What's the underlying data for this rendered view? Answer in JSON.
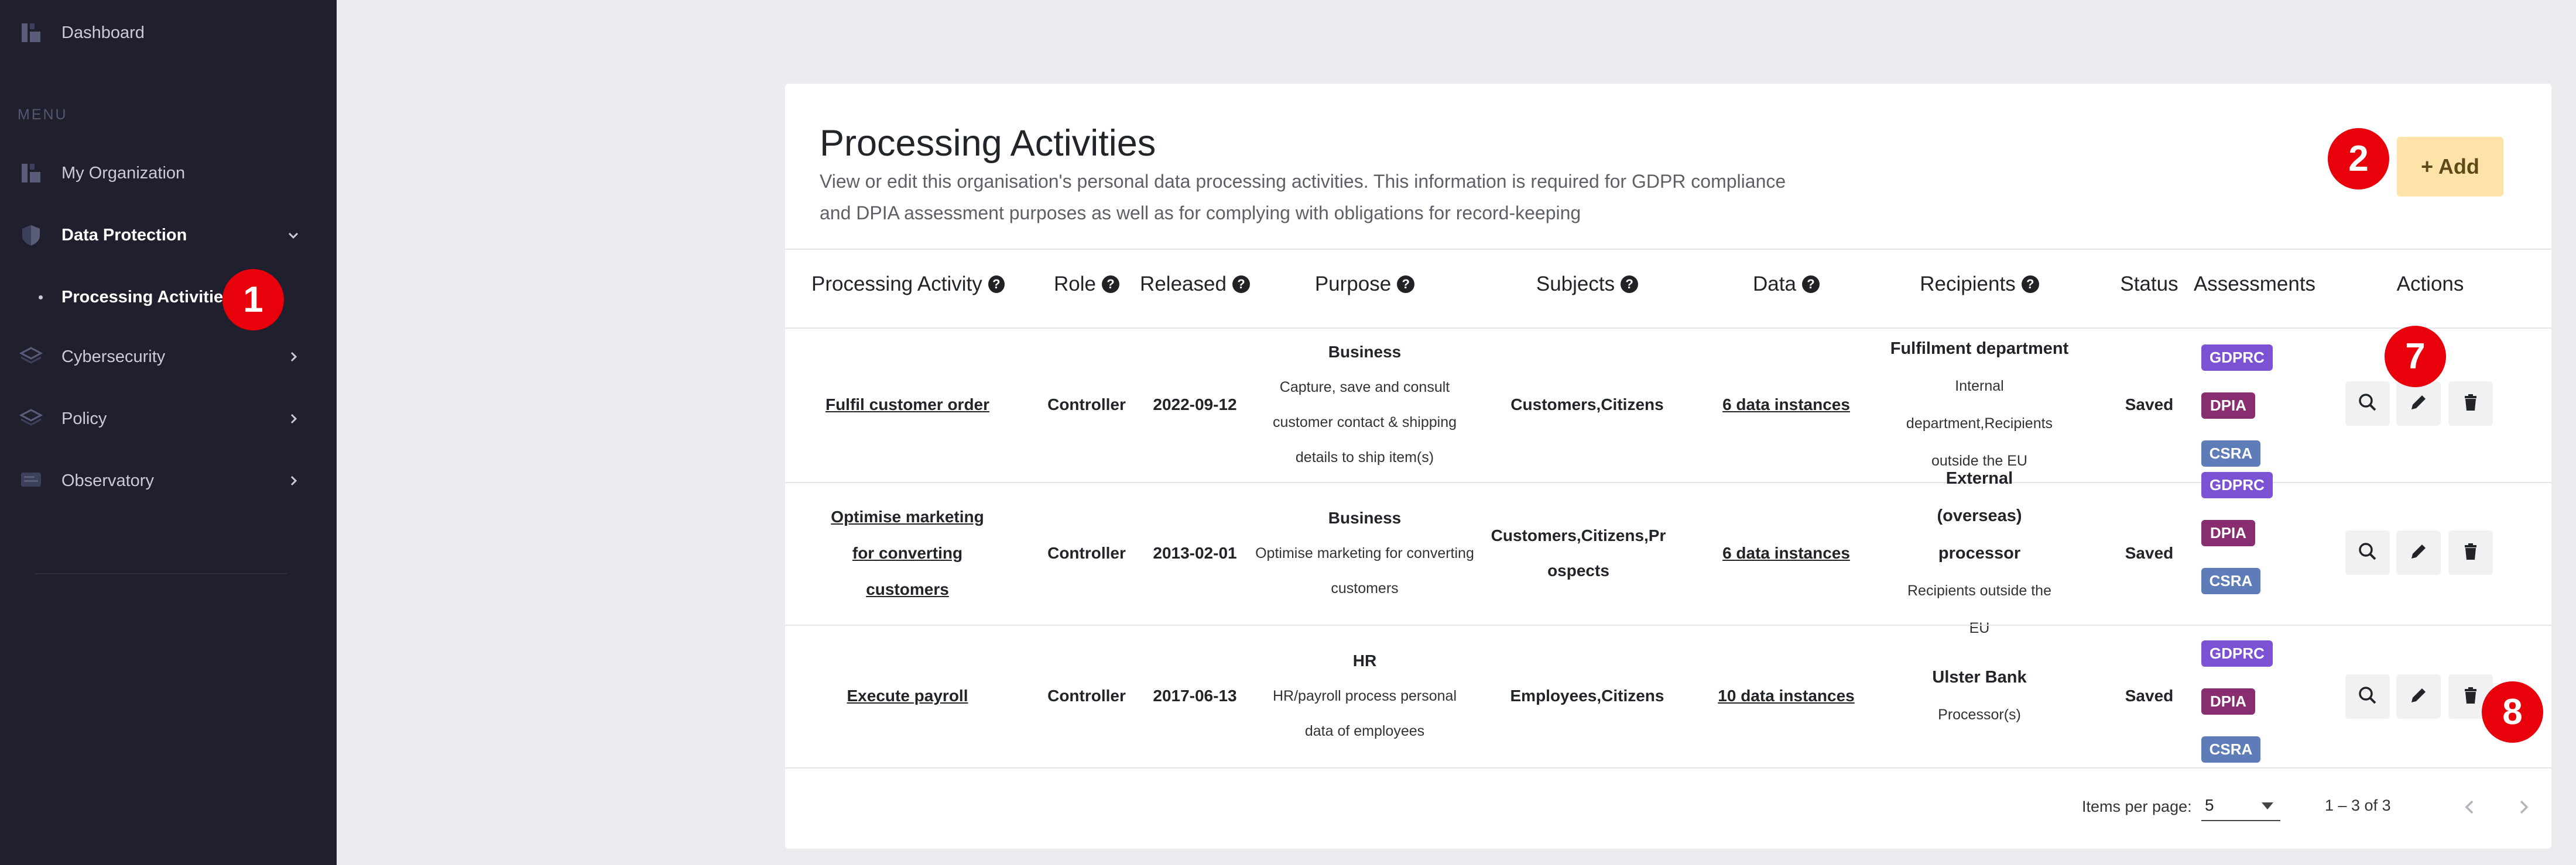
{
  "sidebar": {
    "dashboard": "Dashboard",
    "menu_heading": "MENU",
    "items": [
      {
        "label": "My Organization"
      },
      {
        "label": "Data Protection"
      },
      {
        "label": "Cybersecurity"
      },
      {
        "label": "Policy"
      },
      {
        "label": "Observatory"
      }
    ],
    "sub_item": "Processing Activities"
  },
  "badges": [
    "1",
    "2",
    "7",
    "8"
  ],
  "page": {
    "title": "Processing Activities",
    "description": "View or edit this organisation's personal data processing activities. This information is required for GDPR compliance and DPIA assessment purposes as well as for complying with obligations for record-keeping",
    "add_label": "+ Add"
  },
  "table": {
    "columns": [
      "Processing Activity",
      "Role",
      "Released",
      "Purpose",
      "Subjects",
      "Data",
      "Recipients",
      "Status",
      "Assessments",
      "Actions"
    ],
    "help_glyph": "?",
    "rows": [
      {
        "activity": "Fulfil customer order",
        "role": "Controller",
        "released": "2022-09-12",
        "purpose_title": "Business",
        "purpose_desc": "Capture, save and consult customer contact & shipping details to ship item(s)",
        "subjects": "Customers,Citizens",
        "data": "6 data instances",
        "recipients_title": "Fulfilment department",
        "recipients_desc": "Internal department,Recipients outside the EU",
        "status": "Saved",
        "assessments": [
          "GDPRC",
          "DPIA",
          "CSRA"
        ]
      },
      {
        "activity": "Optimise marketing for converting customers",
        "role": "Controller",
        "released": "2013-02-01",
        "purpose_title": "Business",
        "purpose_desc": "Optimise marketing for converting customers",
        "subjects": "Customers,Citizens,Prospects",
        "data": "6 data instances",
        "recipients_title": "External (overseas) processor",
        "recipients_desc": "Recipients outside the EU",
        "status": "Saved",
        "assessments": [
          "GDPRC",
          "DPIA",
          "CSRA"
        ]
      },
      {
        "activity": "Execute payroll",
        "role": "Controller",
        "released": "2017-06-13",
        "purpose_title": "HR",
        "purpose_desc": "HR/payroll process personal data of employees",
        "subjects": "Employees,Citizens",
        "data": "10 data instances",
        "recipients_title": "Ulster Bank",
        "recipients_desc": "Processor(s)",
        "status": "Saved",
        "assessments": [
          "GDPRC",
          "DPIA",
          "CSRA"
        ]
      }
    ]
  },
  "paginator": {
    "items_per_page_label": "Items per page:",
    "items_per_page": "5",
    "range": "1 – 3 of 3"
  },
  "icons": {
    "view": "search-icon",
    "edit": "pencil-icon",
    "delete": "trash-icon"
  },
  "colors": {
    "sidebar_bg": "#1f1f2e",
    "page_bg": "#ebebf0",
    "badge": "#e8000b",
    "add_button": "#fde3a7",
    "gdprc": "#7b52d4",
    "dpia": "#882d6f",
    "csra": "#5d7cb8"
  }
}
